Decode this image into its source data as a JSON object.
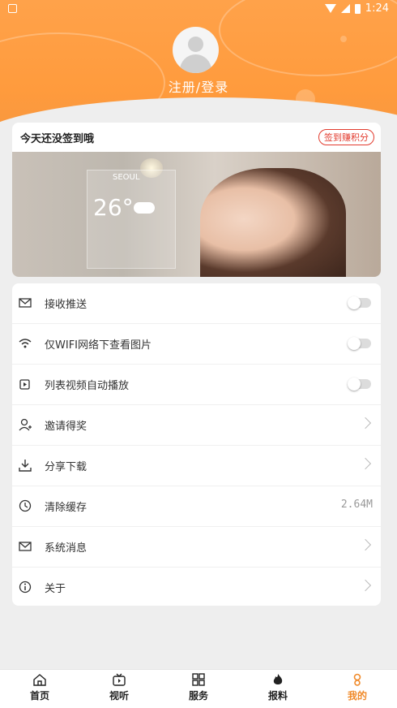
{
  "status_bar": {
    "time": "1:24"
  },
  "profile": {
    "login_label": "注册/登录"
  },
  "checkin": {
    "title": "今天还没签到哦",
    "earn_button": "签到赚积分",
    "banner_weather": {
      "city": "SEOUL",
      "temp": "26°"
    }
  },
  "settings": {
    "items": [
      {
        "label": "接收推送",
        "control": "toggle",
        "icon": "push-icon"
      },
      {
        "label": "仅WIFI网络下查看图片",
        "control": "toggle",
        "icon": "wifi-icon"
      },
      {
        "label": "列表视频自动播放",
        "control": "toggle",
        "icon": "video-icon"
      },
      {
        "label": "邀请得奖",
        "control": "chevron",
        "icon": "invite-icon"
      },
      {
        "label": "分享下载",
        "control": "chevron",
        "icon": "download-icon"
      },
      {
        "label": "清除缓存",
        "control": "value",
        "value": "2.64M",
        "icon": "clear-cache-icon"
      },
      {
        "label": "系统消息",
        "control": "chevron",
        "icon": "mail-icon"
      },
      {
        "label": "关于",
        "control": "chevron",
        "icon": "info-icon"
      }
    ]
  },
  "tabs": [
    {
      "label": "首页",
      "icon": "home-icon"
    },
    {
      "label": "视听",
      "icon": "tv-icon"
    },
    {
      "label": "服务",
      "icon": "grid-icon"
    },
    {
      "label": "报料",
      "icon": "flame-icon"
    },
    {
      "label": "我的",
      "icon": "user-icon",
      "active": true
    }
  ],
  "colors": {
    "accent": "#f08a2a",
    "header": "#ffa24a",
    "badge": "#e23b2e"
  }
}
